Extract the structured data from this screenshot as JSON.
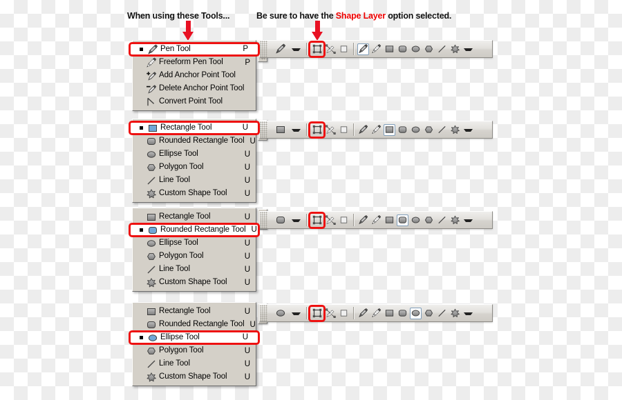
{
  "captions": {
    "left": "When using these Tools...",
    "right_before": "Be sure to have the ",
    "right_highlight": "Shape Layer",
    "right_after": " option selected.",
    "highlight_color": "#ee0000"
  },
  "arrows": [
    {
      "name": "arrow-to-tools",
      "color": "#e81123"
    },
    {
      "name": "arrow-to-shape-layer",
      "color": "#e81123"
    }
  ],
  "panels": [
    {
      "id": "pen-tools",
      "selected_index": 0,
      "items": [
        {
          "label": "Pen Tool",
          "key": "P",
          "icon": "pen-tool-icon",
          "selected": true
        },
        {
          "label": "Freeform Pen Tool",
          "key": "P",
          "icon": "freeform-pen-tool-icon",
          "selected": false
        },
        {
          "label": "Add Anchor Point Tool",
          "key": "",
          "icon": "add-anchor-point-tool-icon",
          "selected": false
        },
        {
          "label": "Delete Anchor Point Tool",
          "key": "",
          "icon": "delete-anchor-point-tool-icon",
          "selected": false
        },
        {
          "label": "Convert Point Tool",
          "key": "",
          "icon": "convert-point-tool-icon",
          "selected": false
        }
      ],
      "optionbar": {
        "tool_preview": "pen-tool-icon",
        "modes": [
          {
            "name": "shape-layers-mode",
            "icon": "shape-layers-icon",
            "selected": false,
            "ringed": true
          },
          {
            "name": "paths-mode",
            "icon": "paths-icon",
            "selected": false,
            "ringed": false
          },
          {
            "name": "fill-pixels-mode",
            "icon": "fill-pixels-icon",
            "selected": false,
            "ringed": false
          }
        ],
        "tools": [
          {
            "name": "pen-tool",
            "icon": "pen-tool-icon",
            "selected": true
          },
          {
            "name": "freeform-pen-tool",
            "icon": "freeform-pen-tool-icon",
            "selected": false
          },
          {
            "name": "rectangle-tool",
            "icon": "rectangle-icon",
            "selected": false
          },
          {
            "name": "rounded-rectangle-tool",
            "icon": "rounded-rectangle-icon",
            "selected": false
          },
          {
            "name": "ellipse-tool",
            "icon": "ellipse-icon",
            "selected": false
          },
          {
            "name": "polygon-tool",
            "icon": "polygon-icon",
            "selected": false
          },
          {
            "name": "line-tool",
            "icon": "line-icon",
            "selected": false
          },
          {
            "name": "custom-shape-tool",
            "icon": "custom-shape-icon",
            "selected": false
          }
        ]
      }
    },
    {
      "id": "rectangle-tools",
      "selected_index": 0,
      "items": [
        {
          "label": "Rectangle Tool",
          "key": "U",
          "icon": "rectangle-icon",
          "selected": true
        },
        {
          "label": "Rounded Rectangle Tool",
          "key": "U",
          "icon": "rounded-rectangle-icon",
          "selected": false
        },
        {
          "label": "Ellipse Tool",
          "key": "U",
          "icon": "ellipse-icon",
          "selected": false
        },
        {
          "label": "Polygon Tool",
          "key": "U",
          "icon": "polygon-icon",
          "selected": false
        },
        {
          "label": "Line Tool",
          "key": "U",
          "icon": "line-icon",
          "selected": false
        },
        {
          "label": "Custom Shape Tool",
          "key": "U",
          "icon": "custom-shape-icon",
          "selected": false
        }
      ],
      "optionbar": {
        "tool_preview": "rectangle-icon",
        "modes": [
          {
            "name": "shape-layers-mode",
            "icon": "shape-layers-icon",
            "selected": false,
            "ringed": true
          },
          {
            "name": "paths-mode",
            "icon": "paths-icon",
            "selected": false,
            "ringed": false
          },
          {
            "name": "fill-pixels-mode",
            "icon": "fill-pixels-icon",
            "selected": false,
            "ringed": false
          }
        ],
        "tools": [
          {
            "name": "pen-tool",
            "icon": "pen-tool-icon",
            "selected": false
          },
          {
            "name": "freeform-pen-tool",
            "icon": "freeform-pen-tool-icon",
            "selected": false
          },
          {
            "name": "rectangle-tool",
            "icon": "rectangle-icon",
            "selected": true
          },
          {
            "name": "rounded-rectangle-tool",
            "icon": "rounded-rectangle-icon",
            "selected": false
          },
          {
            "name": "ellipse-tool",
            "icon": "ellipse-icon",
            "selected": false
          },
          {
            "name": "polygon-tool",
            "icon": "polygon-icon",
            "selected": false
          },
          {
            "name": "line-tool",
            "icon": "line-icon",
            "selected": false
          },
          {
            "name": "custom-shape-tool",
            "icon": "custom-shape-icon",
            "selected": false
          }
        ]
      }
    },
    {
      "id": "rounded-rectangle-tools",
      "selected_index": 1,
      "items": [
        {
          "label": "Rectangle Tool",
          "key": "U",
          "icon": "rectangle-icon",
          "selected": false
        },
        {
          "label": "Rounded Rectangle Tool",
          "key": "U",
          "icon": "rounded-rectangle-icon",
          "selected": true
        },
        {
          "label": "Ellipse Tool",
          "key": "U",
          "icon": "ellipse-icon",
          "selected": false
        },
        {
          "label": "Polygon Tool",
          "key": "U",
          "icon": "polygon-icon",
          "selected": false
        },
        {
          "label": "Line Tool",
          "key": "U",
          "icon": "line-icon",
          "selected": false
        },
        {
          "label": "Custom Shape Tool",
          "key": "U",
          "icon": "custom-shape-icon",
          "selected": false
        }
      ],
      "optionbar": {
        "tool_preview": "rounded-rectangle-icon",
        "modes": [
          {
            "name": "shape-layers-mode",
            "icon": "shape-layers-icon",
            "selected": false,
            "ringed": true
          },
          {
            "name": "paths-mode",
            "icon": "paths-icon",
            "selected": false,
            "ringed": false
          },
          {
            "name": "fill-pixels-mode",
            "icon": "fill-pixels-icon",
            "selected": false,
            "ringed": false
          }
        ],
        "tools": [
          {
            "name": "pen-tool",
            "icon": "pen-tool-icon",
            "selected": false
          },
          {
            "name": "freeform-pen-tool",
            "icon": "freeform-pen-tool-icon",
            "selected": false
          },
          {
            "name": "rectangle-tool",
            "icon": "rectangle-icon",
            "selected": false
          },
          {
            "name": "rounded-rectangle-tool",
            "icon": "rounded-rectangle-icon",
            "selected": true
          },
          {
            "name": "ellipse-tool",
            "icon": "ellipse-icon",
            "selected": false
          },
          {
            "name": "polygon-tool",
            "icon": "polygon-icon",
            "selected": false
          },
          {
            "name": "line-tool",
            "icon": "line-icon",
            "selected": false
          },
          {
            "name": "custom-shape-tool",
            "icon": "custom-shape-icon",
            "selected": false
          }
        ]
      }
    },
    {
      "id": "ellipse-tools",
      "selected_index": 2,
      "items": [
        {
          "label": "Rectangle Tool",
          "key": "U",
          "icon": "rectangle-icon",
          "selected": false
        },
        {
          "label": "Rounded Rectangle Tool",
          "key": "U",
          "icon": "rounded-rectangle-icon",
          "selected": false
        },
        {
          "label": "Ellipse Tool",
          "key": "U",
          "icon": "ellipse-icon",
          "selected": true
        },
        {
          "label": "Polygon Tool",
          "key": "U",
          "icon": "polygon-icon",
          "selected": false
        },
        {
          "label": "Line Tool",
          "key": "U",
          "icon": "line-icon",
          "selected": false
        },
        {
          "label": "Custom Shape Tool",
          "key": "U",
          "icon": "custom-shape-icon",
          "selected": false
        }
      ],
      "optionbar": {
        "tool_preview": "ellipse-icon",
        "modes": [
          {
            "name": "shape-layers-mode",
            "icon": "shape-layers-icon",
            "selected": false,
            "ringed": true
          },
          {
            "name": "paths-mode",
            "icon": "paths-icon",
            "selected": false,
            "ringed": false
          },
          {
            "name": "fill-pixels-mode",
            "icon": "fill-pixels-icon",
            "selected": false,
            "ringed": false
          }
        ],
        "tools": [
          {
            "name": "pen-tool",
            "icon": "pen-tool-icon",
            "selected": false
          },
          {
            "name": "freeform-pen-tool",
            "icon": "freeform-pen-tool-icon",
            "selected": false
          },
          {
            "name": "rectangle-tool",
            "icon": "rectangle-icon",
            "selected": false
          },
          {
            "name": "rounded-rectangle-tool",
            "icon": "rounded-rectangle-icon",
            "selected": false
          },
          {
            "name": "ellipse-tool",
            "icon": "ellipse-icon",
            "selected": true
          },
          {
            "name": "polygon-tool",
            "icon": "polygon-icon",
            "selected": false
          },
          {
            "name": "line-tool",
            "icon": "line-icon",
            "selected": false
          },
          {
            "name": "custom-shape-tool",
            "icon": "custom-shape-icon",
            "selected": false
          }
        ]
      }
    }
  ]
}
